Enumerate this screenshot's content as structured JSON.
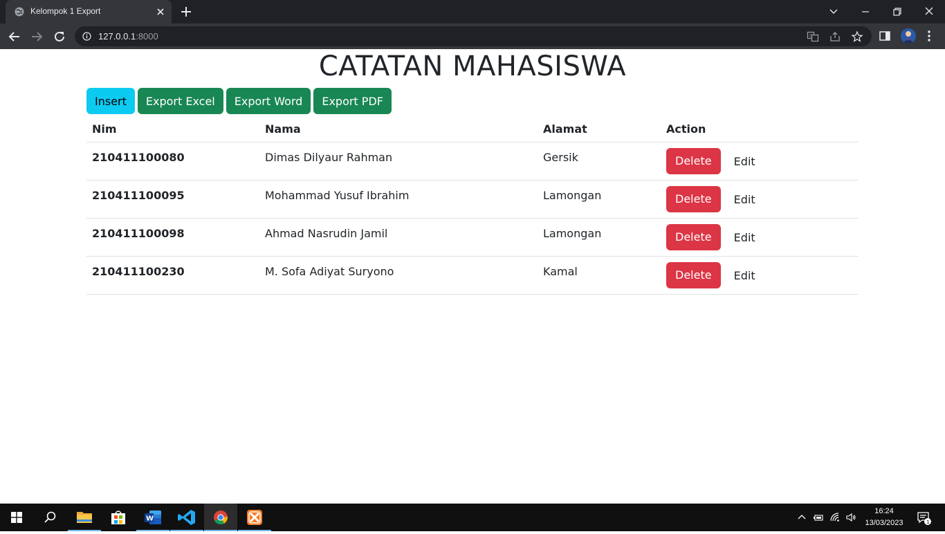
{
  "browser": {
    "tab_title": "Kelompok 1 Export",
    "url_host": "127.0.0.1",
    "url_port": ":8000"
  },
  "page": {
    "title": "CATATAN MAHASISWA",
    "buttons": {
      "insert": "Insert",
      "export_excel": "Export Excel",
      "export_word": "Export Word",
      "export_pdf": "Export PDF"
    },
    "table": {
      "headers": [
        "Nim",
        "Nama",
        "Alamat",
        "Action"
      ],
      "rows": [
        {
          "nim": "210411100080",
          "nama": "Dimas Dilyaur Rahman",
          "alamat": "Gersik",
          "delete": "Delete",
          "edit": "Edit"
        },
        {
          "nim": "210411100095",
          "nama": "Mohammad Yusuf Ibrahim",
          "alamat": "Lamongan",
          "delete": "Delete",
          "edit": "Edit"
        },
        {
          "nim": "210411100098",
          "nama": "Ahmad Nasrudin Jamil",
          "alamat": "Lamongan",
          "delete": "Delete",
          "edit": "Edit"
        },
        {
          "nim": "210411100230",
          "nama": "M. Sofa Adiyat Suryono",
          "alamat": "Kamal",
          "delete": "Delete",
          "edit": "Edit"
        }
      ]
    }
  },
  "taskbar": {
    "time": "16:24",
    "date": "13/03/2023",
    "notification_count": "1",
    "apps": [
      "start-icon",
      "search-icon",
      "file-explorer-icon",
      "microsoft-store-icon",
      "word-icon",
      "vscode-icon",
      "chrome-icon",
      "xampp-icon"
    ]
  },
  "colors": {
    "info": "#0dcaf0",
    "success": "#198754",
    "danger": "#dc3545",
    "chrome_dark": "#202124",
    "chrome_tab": "#35363a"
  }
}
